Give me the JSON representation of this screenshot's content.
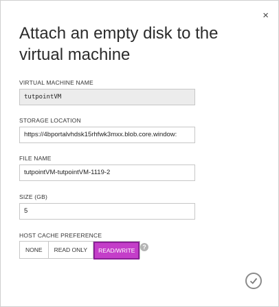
{
  "dialog": {
    "title": "Attach an empty disk to the virtual machine",
    "close_glyph": "×"
  },
  "fields": {
    "vm_name": {
      "label": "VIRTUAL MACHINE NAME",
      "value": "tutpointVM"
    },
    "storage_location": {
      "label": "STORAGE LOCATION",
      "value": "https://4bportalvhdsk15rhfwk3mxx.blob.core.window:"
    },
    "file_name": {
      "label": "FILE NAME",
      "value": "tutpointVM-tutpointVM-1119-2"
    },
    "size": {
      "label": "SIZE (GB)",
      "value": "5"
    }
  },
  "host_cache": {
    "label": "HOST CACHE PREFERENCE",
    "options": [
      "NONE",
      "READ ONLY",
      "READ/WRITE"
    ],
    "selected": "READ/WRITE",
    "help_glyph": "?"
  },
  "footer": {
    "confirm_icon": "checkmark-icon"
  },
  "colors": {
    "accent": "#c43ec9",
    "accent_border": "#8a1f96"
  }
}
